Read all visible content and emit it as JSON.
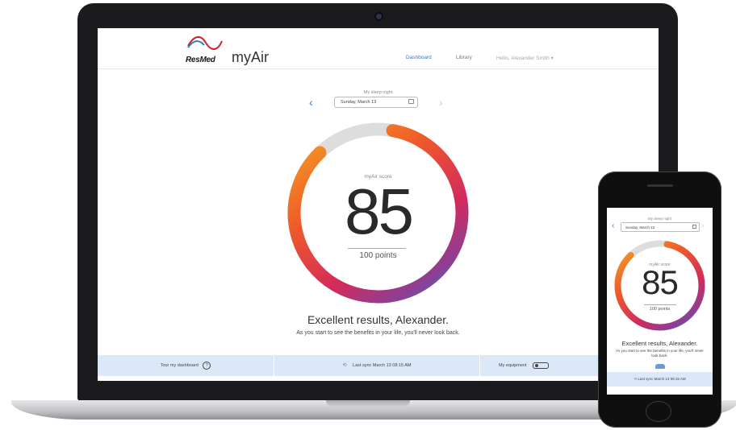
{
  "laptop": {
    "brand_resmed": "ResMed",
    "brand_myair": "myAir",
    "nav": {
      "dashboard": "Dashboard",
      "library": "Library",
      "user": "Hello, Alexander Smith ▾"
    },
    "date_caption": "My sleep night",
    "date_value": "Sunday, March 13",
    "score_label": "myAir score",
    "score": "85",
    "score_points": "100 points",
    "score_fraction": 0.85,
    "result_title": "Excellent results, Alexander.",
    "result_sub": "As you start to see the benefits in your life, you'll never look back.",
    "footer": {
      "tour": "Tour my dashboard",
      "sync": "Last sync March 13 08:15 AM",
      "equipment": "My equipment"
    }
  },
  "phone": {
    "date_caption": "My sleep night",
    "date_value": "Sunday, March 13",
    "score_label": "myAir score",
    "score": "85",
    "score_points": "100 points",
    "result_title": "Excellent results, Alexander.",
    "result_sub": "As you start to see the benefits in your life, you'll never look back.",
    "footer_sync": "Last sync March 13 08:15 AM"
  },
  "colors": {
    "accent_blue": "#3a78c2",
    "footer_bg": "#dce8f7",
    "ring_track": "#dddddd",
    "ring_gradient": [
      "#f6a623",
      "#f07a25",
      "#e8452e",
      "#d42a5b",
      "#a23a8a",
      "#5a58b8",
      "#3a78c2"
    ]
  },
  "icons": {
    "prev": "chevron-left-icon",
    "next": "chevron-right-icon",
    "calendar": "calendar-icon",
    "help": "help-circle-icon",
    "sync": "sync-icon",
    "equipment": "cpap-device-icon"
  }
}
